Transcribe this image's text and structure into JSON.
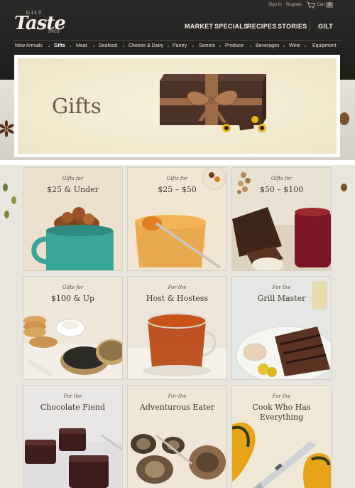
{
  "header": {
    "logo_small": "GILT",
    "logo_main": "Taste",
    "logo_beta": "beta",
    "utility": {
      "sign_in": "Sign In",
      "register": "Register",
      "cart": "Cart",
      "cart_count": "0"
    },
    "main_nav": [
      "MARKET",
      "SPECIALS",
      "RECIPES",
      "STORIES",
      "GILT"
    ],
    "sub_nav": [
      "New Arrivals",
      "Gifts",
      "Meat",
      "Seafood",
      "Cheese & Dairy",
      "Pantry",
      "Sweets",
      "Produce",
      "Beverages",
      "Wine",
      "Equipment"
    ],
    "active_sub_nav": "Gifts"
  },
  "hero": {
    "title": "Gifts"
  },
  "tiles": [
    {
      "line1": "Gifts for",
      "line2": "$25 & Under"
    },
    {
      "line1": "Gifts for",
      "line2": "$25 – $50"
    },
    {
      "line1": "Gifts for",
      "line2": "$50 – $100"
    },
    {
      "line1": "Gifts for",
      "line2": "$100 & Up"
    },
    {
      "line1": "For the",
      "line2": "Host & Hostess"
    },
    {
      "line1": "For the",
      "line2": "Grill Master"
    },
    {
      "line1": "For the",
      "line2": "Chocolate Fiend"
    },
    {
      "line1": "For the",
      "line2": "Adventurous Eater"
    },
    {
      "line1": "For the",
      "line2": "Cook Who Has",
      "line3": "Everything"
    }
  ],
  "colors": {
    "header_bg": "#262422",
    "accent_text": "#3f342c",
    "hero_title": "#6b5a4a"
  }
}
